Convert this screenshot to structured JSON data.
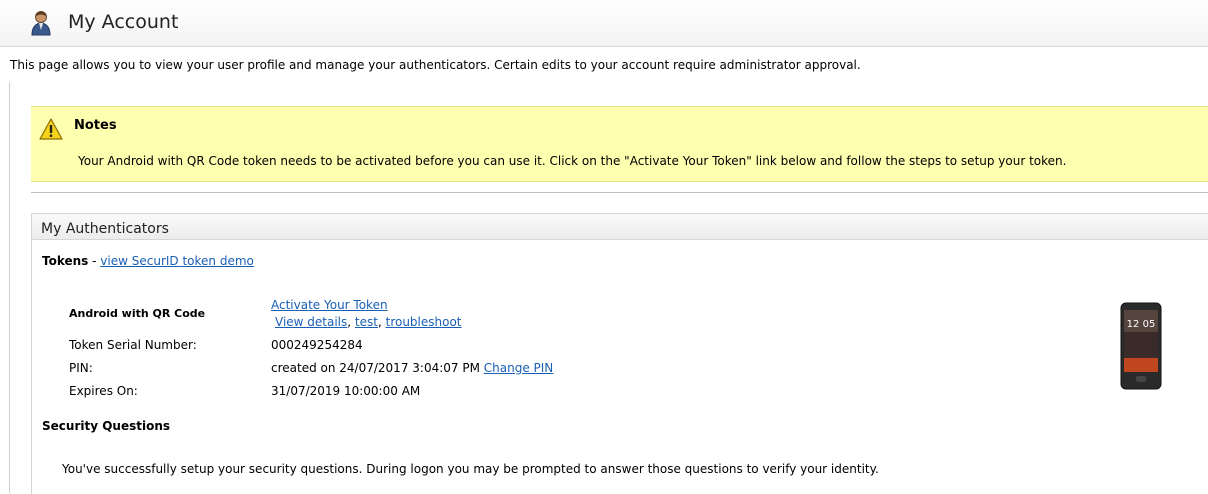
{
  "header": {
    "title": "My Account",
    "icon": "user-icon"
  },
  "intro": "This page allows you to view your user profile and manage your authenticators. Certain edits to your account require administrator approval.",
  "notes": {
    "title": "Notes",
    "icon": "warning-icon",
    "text": "Your Android with QR Code token needs to be activated before you can use it. Click on the \"Activate Your Token\" link below and follow the steps to setup your token."
  },
  "authenticators": {
    "title": "My Authenticators",
    "tokens_label": "Tokens",
    "tokens_separator": " - ",
    "token_demo_link": "view SecurID token demo",
    "token": {
      "type_label": "Android with QR Code",
      "activate_link": "Activate Your Token",
      "view_details_link": "View details",
      "test_link": "test",
      "troubleshoot_link": "troubleshoot",
      "serial_label": "Token Serial Number:",
      "serial_value": "000249254284",
      "pin_label": "PIN:",
      "pin_value": "created on 24/07/2017 3:04:07 PM",
      "change_pin_link": "Change PIN",
      "expires_label": "Expires On:",
      "expires_value": "31/07/2019 10:00:00 AM",
      "device_clock": "12 05"
    },
    "security_questions": {
      "title": "Security Questions",
      "text": "You've successfully setup your security questions. During logon you may be prompted to answer those questions to verify your identity."
    }
  }
}
